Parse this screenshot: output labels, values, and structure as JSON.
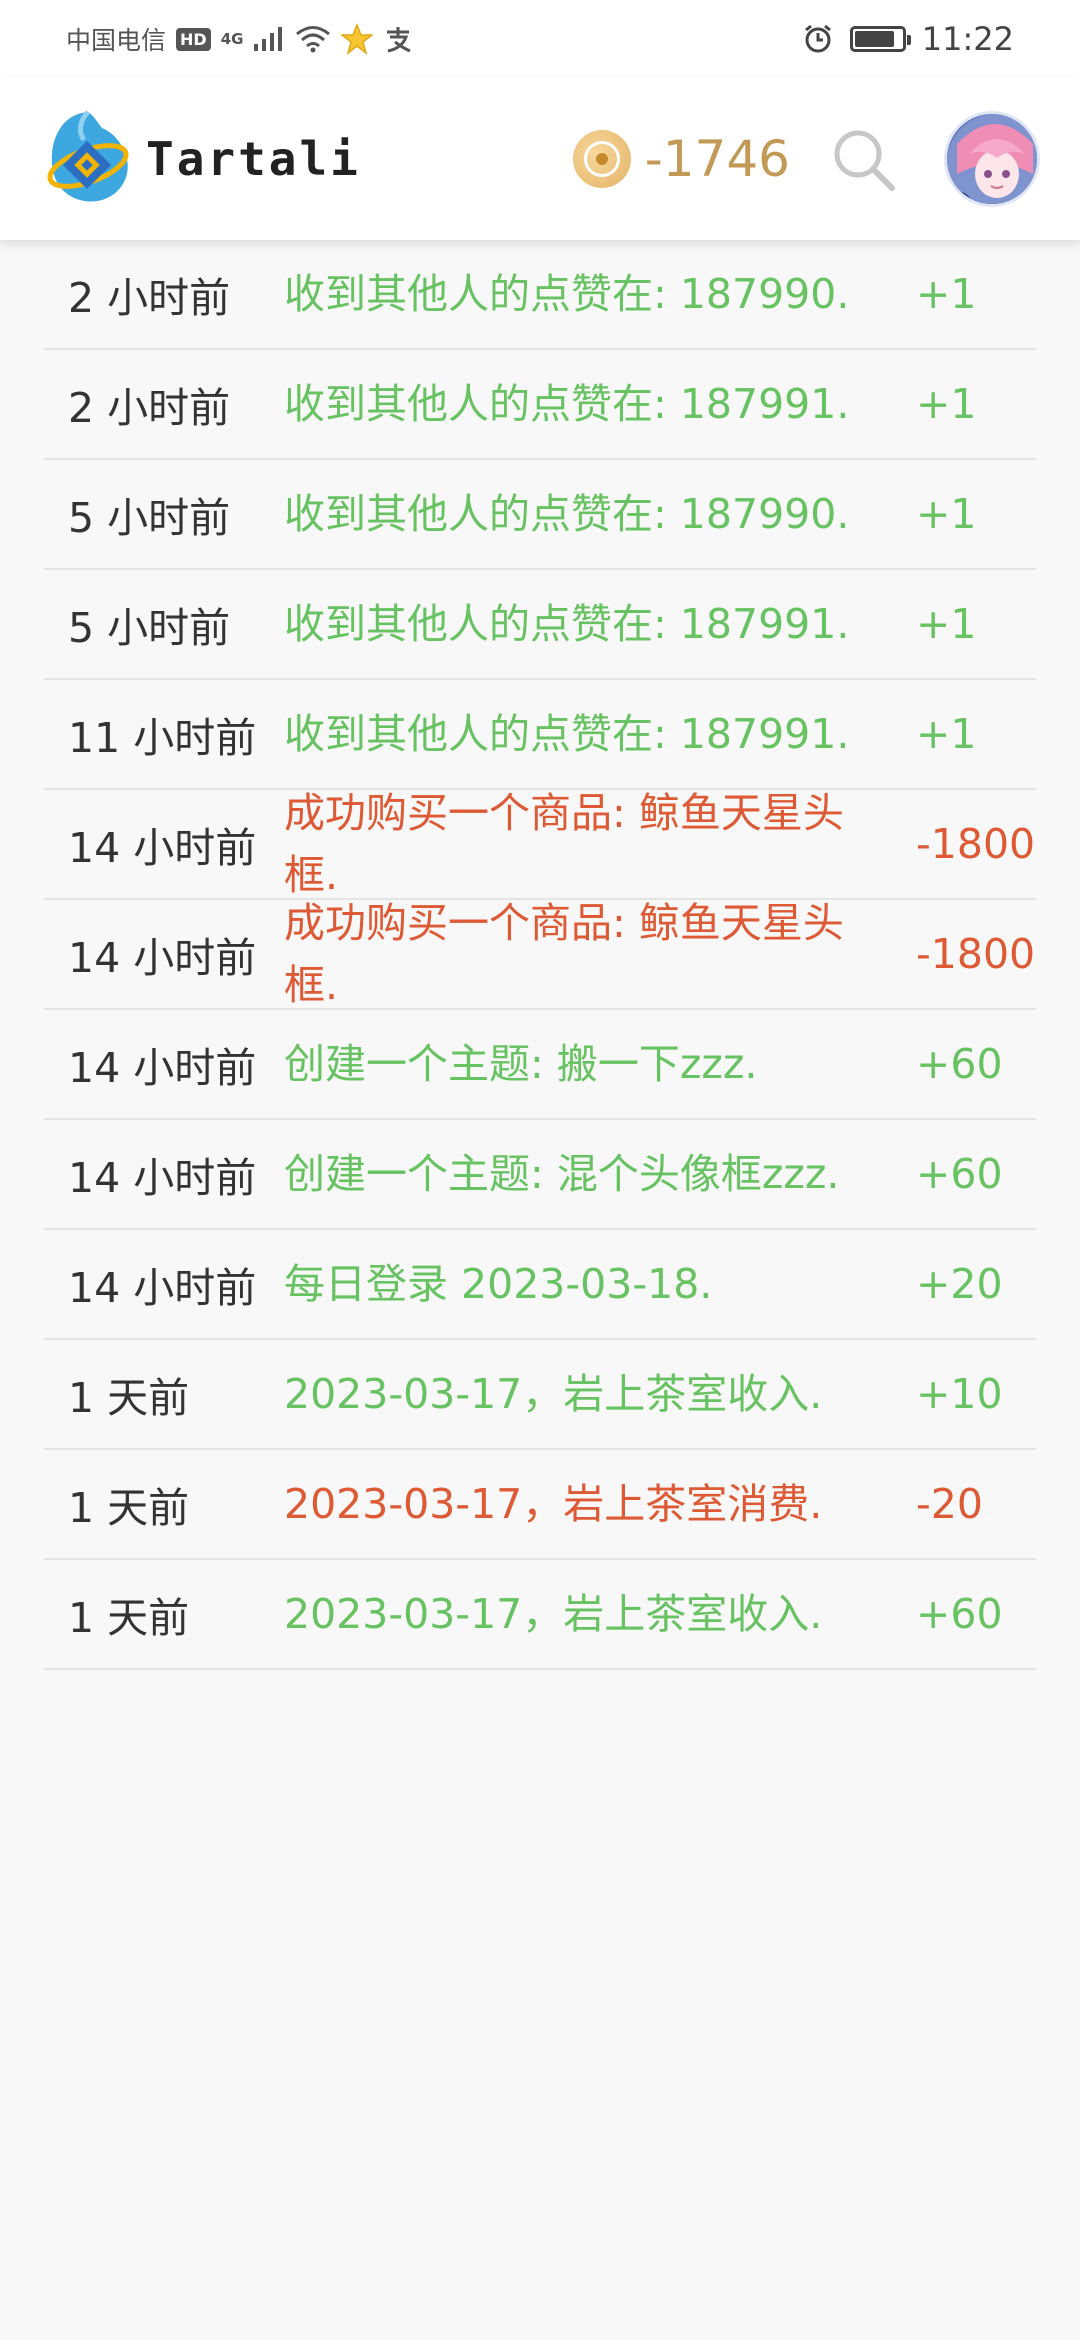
{
  "status_bar": {
    "carrier": "中国电信",
    "hd": "HD",
    "network": "4G",
    "time": "11:22",
    "icons": [
      "signal-icon",
      "wifi-icon",
      "star-icon",
      "alipay-icon",
      "alarm-icon",
      "battery-icon"
    ]
  },
  "header": {
    "brand": "Tartali",
    "points": "-1746",
    "icons": [
      "logo-icon",
      "coin-icon",
      "search-icon",
      "avatar"
    ]
  },
  "colors": {
    "positive": "#67c261",
    "negative": "#dd5a35",
    "points": "#c39a55"
  },
  "records": [
    {
      "time": "2 小时前",
      "desc": "收到其他人的点赞在: 187990.",
      "amount": "+1",
      "type": "positive"
    },
    {
      "time": "2 小时前",
      "desc": "收到其他人的点赞在: 187991.",
      "amount": "+1",
      "type": "positive"
    },
    {
      "time": "5 小时前",
      "desc": "收到其他人的点赞在: 187990.",
      "amount": "+1",
      "type": "positive"
    },
    {
      "time": "5 小时前",
      "desc": "收到其他人的点赞在: 187991.",
      "amount": "+1",
      "type": "positive"
    },
    {
      "time": "11 小时前",
      "desc": "收到其他人的点赞在: 187991.",
      "amount": "+1",
      "type": "positive"
    },
    {
      "time": "14 小时前",
      "desc": "成功购买一个商品: 鲸鱼天星头框.",
      "amount": "-1800",
      "type": "negative"
    },
    {
      "time": "14 小时前",
      "desc": "成功购买一个商品: 鲸鱼天星头框.",
      "amount": "-1800",
      "type": "negative"
    },
    {
      "time": "14 小时前",
      "desc": "创建一个主题: 搬一下zzz.",
      "amount": "+60",
      "type": "positive"
    },
    {
      "time": "14 小时前",
      "desc": "创建一个主题: 混个头像框zzz.",
      "amount": "+60",
      "type": "positive"
    },
    {
      "time": "14 小时前",
      "desc": "每日登录 2023-03-18.",
      "amount": "+20",
      "type": "positive"
    },
    {
      "time": "1 天前",
      "desc": "2023-03-17，岩上茶室收入.",
      "amount": "+10",
      "type": "positive"
    },
    {
      "time": "1 天前",
      "desc": "2023-03-17，岩上茶室消费.",
      "amount": "-20",
      "type": "negative"
    },
    {
      "time": "1 天前",
      "desc": "2023-03-17，岩上茶室收入.",
      "amount": "+60",
      "type": "positive"
    }
  ]
}
